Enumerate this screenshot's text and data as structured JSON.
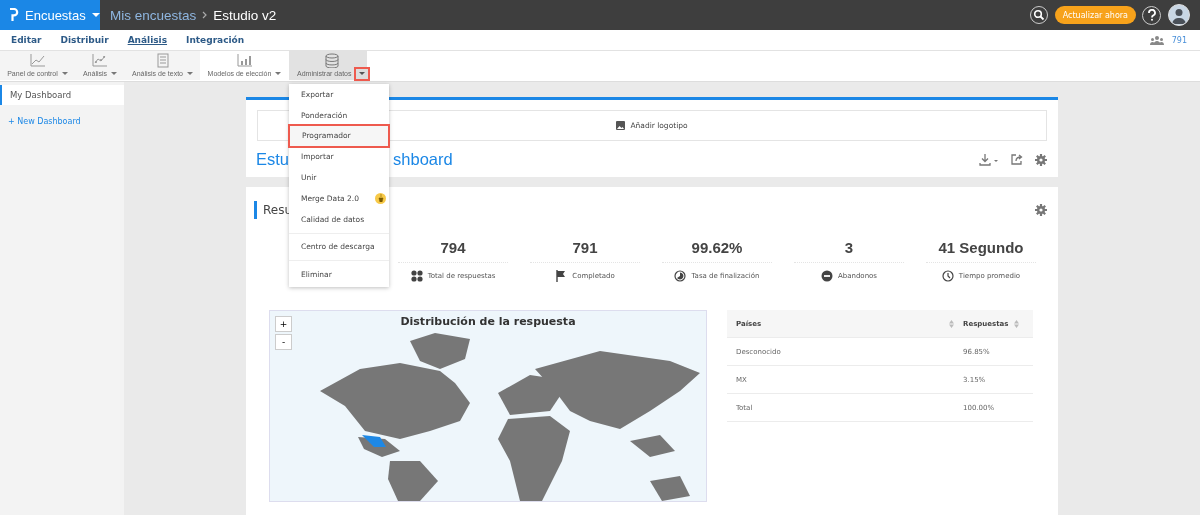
{
  "topbar": {
    "brand": "Encuestas",
    "breadcrumb": [
      "Mis encuestas",
      "Estudio v2"
    ],
    "upgrade_button": "Actualizar ahora"
  },
  "nav": {
    "tabs": [
      {
        "label": "Editar",
        "selected": false
      },
      {
        "label": "Distribuir",
        "selected": false
      },
      {
        "label": "Análisis",
        "selected": true
      },
      {
        "label": "Integración",
        "selected": false
      }
    ],
    "respondents": "791"
  },
  "toolbar": [
    {
      "label": "Panel de control",
      "kind": "line",
      "selected": false
    },
    {
      "label": "Análisis",
      "kind": "scatter",
      "selected": false
    },
    {
      "label": "Análisis de texto",
      "kind": "text",
      "selected": false
    },
    {
      "label": "Modelos de elección",
      "kind": "bars",
      "selected": false
    },
    {
      "label": "Administrar datos",
      "kind": "database",
      "selected": true
    }
  ],
  "sidebar": {
    "items": [
      {
        "label": "My Dashboard",
        "selected": true
      }
    ],
    "new_button": "+ New Dashboard"
  },
  "menu": {
    "groups": [
      [
        {
          "label": "Exportar",
          "selected": false,
          "badge": false
        },
        {
          "label": "Ponderación",
          "selected": false,
          "badge": false
        },
        {
          "label": "Programador",
          "selected": true,
          "badge": false
        },
        {
          "label": "Importar",
          "selected": false,
          "badge": false
        },
        {
          "label": "Unir",
          "selected": false,
          "badge": false
        },
        {
          "label": "Merge Data 2.0",
          "selected": false,
          "badge": true
        },
        {
          "label": "Calidad de datos",
          "selected": false,
          "badge": false
        }
      ],
      [
        {
          "label": "Centro de descarga",
          "selected": false,
          "badge": false
        }
      ],
      [
        {
          "label": "Eliminar",
          "selected": false,
          "badge": false
        }
      ]
    ]
  },
  "dashboard": {
    "logo_button": "Añadir logotipo",
    "title_visible_parts": [
      "Estu",
      "shboard"
    ]
  },
  "summary": {
    "title_visible_part": "Resu",
    "stats": [
      {
        "value": "794",
        "label": "Total de respuestas",
        "kind": "dots"
      },
      {
        "value": "791",
        "label": "Completado",
        "kind": "flag"
      },
      {
        "value": "99.62%",
        "label": "Tasa de finalización",
        "kind": "pie"
      },
      {
        "value": "3",
        "label": "Abandonos",
        "kind": "minus"
      },
      {
        "value": "41 Segundo",
        "label": "Tiempo promedio",
        "kind": "clock"
      }
    ]
  },
  "map": {
    "title": "Distribución de la respuesta",
    "zoom_in": "+",
    "zoom_out": "-"
  },
  "table": {
    "columns": [
      "Países",
      "Respuestas"
    ],
    "rows": [
      [
        "Desconocido",
        "96.85%"
      ],
      [
        "MX",
        "3.15%"
      ],
      [
        "Total",
        "100.00%"
      ]
    ]
  }
}
